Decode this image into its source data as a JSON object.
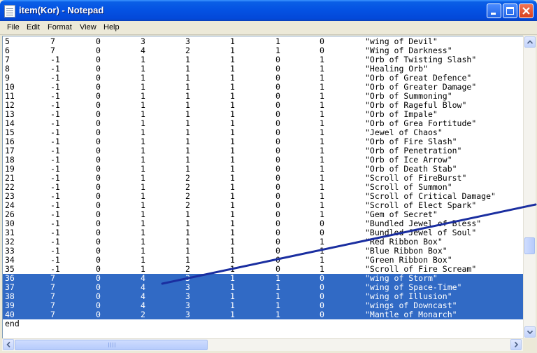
{
  "window": {
    "title": "item(Kor) - Notepad"
  },
  "menu": [
    "File",
    "Edit",
    "Format",
    "View",
    "Help"
  ],
  "rows": [
    {
      "c": [
        "5",
        "7",
        "0",
        "3",
        "3",
        "1",
        "1",
        "0",
        "\"wing of Devil\""
      ],
      "sel": false
    },
    {
      "c": [
        "6",
        "7",
        "0",
        "4",
        "2",
        "1",
        "1",
        "0",
        "\"Wing of Darkness\""
      ],
      "sel": false
    },
    {
      "c": [
        "7",
        "-1",
        "0",
        "1",
        "1",
        "1",
        "0",
        "1",
        "\"Orb of Twisting Slash\""
      ],
      "sel": false
    },
    {
      "c": [
        "8",
        "-1",
        "0",
        "1",
        "1",
        "1",
        "0",
        "1",
        "\"Healing Orb\""
      ],
      "sel": false
    },
    {
      "c": [
        "9",
        "-1",
        "0",
        "1",
        "1",
        "1",
        "0",
        "1",
        "\"Orb of Great Defence\""
      ],
      "sel": false
    },
    {
      "c": [
        "10",
        "-1",
        "0",
        "1",
        "1",
        "1",
        "0",
        "1",
        "\"Orb of Greater Damage\""
      ],
      "sel": false
    },
    {
      "c": [
        "11",
        "-1",
        "0",
        "1",
        "1",
        "1",
        "0",
        "1",
        "\"Orb of Summoning\""
      ],
      "sel": false
    },
    {
      "c": [
        "12",
        "-1",
        "0",
        "1",
        "1",
        "1",
        "0",
        "1",
        "\"Orb of Rageful Blow\""
      ],
      "sel": false
    },
    {
      "c": [
        "13",
        "-1",
        "0",
        "1",
        "1",
        "1",
        "0",
        "1",
        "\"Orb of Impale\""
      ],
      "sel": false
    },
    {
      "c": [
        "14",
        "-1",
        "0",
        "1",
        "1",
        "1",
        "0",
        "1",
        "\"Orb of Grea Fortitude\""
      ],
      "sel": false
    },
    {
      "c": [
        "15",
        "-1",
        "0",
        "1",
        "1",
        "1",
        "0",
        "1",
        "\"Jewel of Chaos\""
      ],
      "sel": false
    },
    {
      "c": [
        "16",
        "-1",
        "0",
        "1",
        "1",
        "1",
        "0",
        "1",
        "\"Orb of Fire Slash\""
      ],
      "sel": false
    },
    {
      "c": [
        "17",
        "-1",
        "0",
        "1",
        "1",
        "1",
        "0",
        "1",
        "\"Orb of Penetration\""
      ],
      "sel": false
    },
    {
      "c": [
        "18",
        "-1",
        "0",
        "1",
        "1",
        "1",
        "0",
        "1",
        "\"Orb of Ice Arrow\""
      ],
      "sel": false
    },
    {
      "c": [
        "19",
        "-1",
        "0",
        "1",
        "1",
        "1",
        "0",
        "1",
        "\"Orb of Death Stab\""
      ],
      "sel": false
    },
    {
      "c": [
        "21",
        "-1",
        "0",
        "1",
        "2",
        "1",
        "0",
        "1",
        "\"Scroll of FireBurst\""
      ],
      "sel": false
    },
    {
      "c": [
        "22",
        "-1",
        "0",
        "1",
        "2",
        "1",
        "0",
        "1",
        "\"Scroll of Summon\""
      ],
      "sel": false
    },
    {
      "c": [
        "23",
        "-1",
        "0",
        "1",
        "2",
        "1",
        "0",
        "1",
        "\"Scroll of Critical Damage\""
      ],
      "sel": false
    },
    {
      "c": [
        "24",
        "-1",
        "0",
        "1",
        "2",
        "1",
        "0",
        "1",
        "\"Scroll of Elect Spark\""
      ],
      "sel": false
    },
    {
      "c": [
        "26",
        "-1",
        "0",
        "1",
        "1",
        "1",
        "0",
        "1",
        "\"Gem of Secret\""
      ],
      "sel": false
    },
    {
      "c": [
        "30",
        "-1",
        "0",
        "1",
        "1",
        "1",
        "0",
        "0",
        "\"Bundled Jewel of Bless\""
      ],
      "sel": false
    },
    {
      "c": [
        "31",
        "-1",
        "0",
        "1",
        "1",
        "1",
        "0",
        "0",
        "\"Bundled Jewel of Soul\""
      ],
      "sel": false
    },
    {
      "c": [
        "32",
        "-1",
        "0",
        "1",
        "1",
        "1",
        "0",
        "1",
        "\"Red Ribbon Box\""
      ],
      "sel": false
    },
    {
      "c": [
        "33",
        "-1",
        "0",
        "1",
        "1",
        "1",
        "0",
        "1",
        "\"Blue Ribbon Box\""
      ],
      "sel": false
    },
    {
      "c": [
        "34",
        "-1",
        "0",
        "1",
        "1",
        "1",
        "0",
        "1",
        "\"Green Ribbon Box\""
      ],
      "sel": false
    },
    {
      "c": [
        "35",
        "-1",
        "0",
        "1",
        "2",
        "1",
        "0",
        "1",
        "\"Scroll of Fire Scream\""
      ],
      "sel": false
    },
    {
      "c": [
        "36",
        "7",
        "0",
        "4",
        "3",
        "1",
        "1",
        "0",
        "\"wing of Storm\""
      ],
      "sel": true
    },
    {
      "c": [
        "37",
        "7",
        "0",
        "4",
        "3",
        "1",
        "1",
        "0",
        "\"wing of Space-Time\""
      ],
      "sel": true
    },
    {
      "c": [
        "38",
        "7",
        "0",
        "4",
        "3",
        "1",
        "1",
        "0",
        "\"wing of Illusion\""
      ],
      "sel": true
    },
    {
      "c": [
        "39",
        "7",
        "0",
        "4",
        "3",
        "1",
        "1",
        "0",
        "\"wings of Downcast\""
      ],
      "sel": true
    },
    {
      "c": [
        "40",
        "7",
        "0",
        "2",
        "3",
        "1",
        "1",
        "0",
        "\"Mantle of Monarch\""
      ],
      "sel": true
    },
    {
      "c": [
        "end"
      ],
      "sel": false
    }
  ],
  "colors": {
    "selection": "#316ac5",
    "annotation": "#1a2ea0"
  }
}
